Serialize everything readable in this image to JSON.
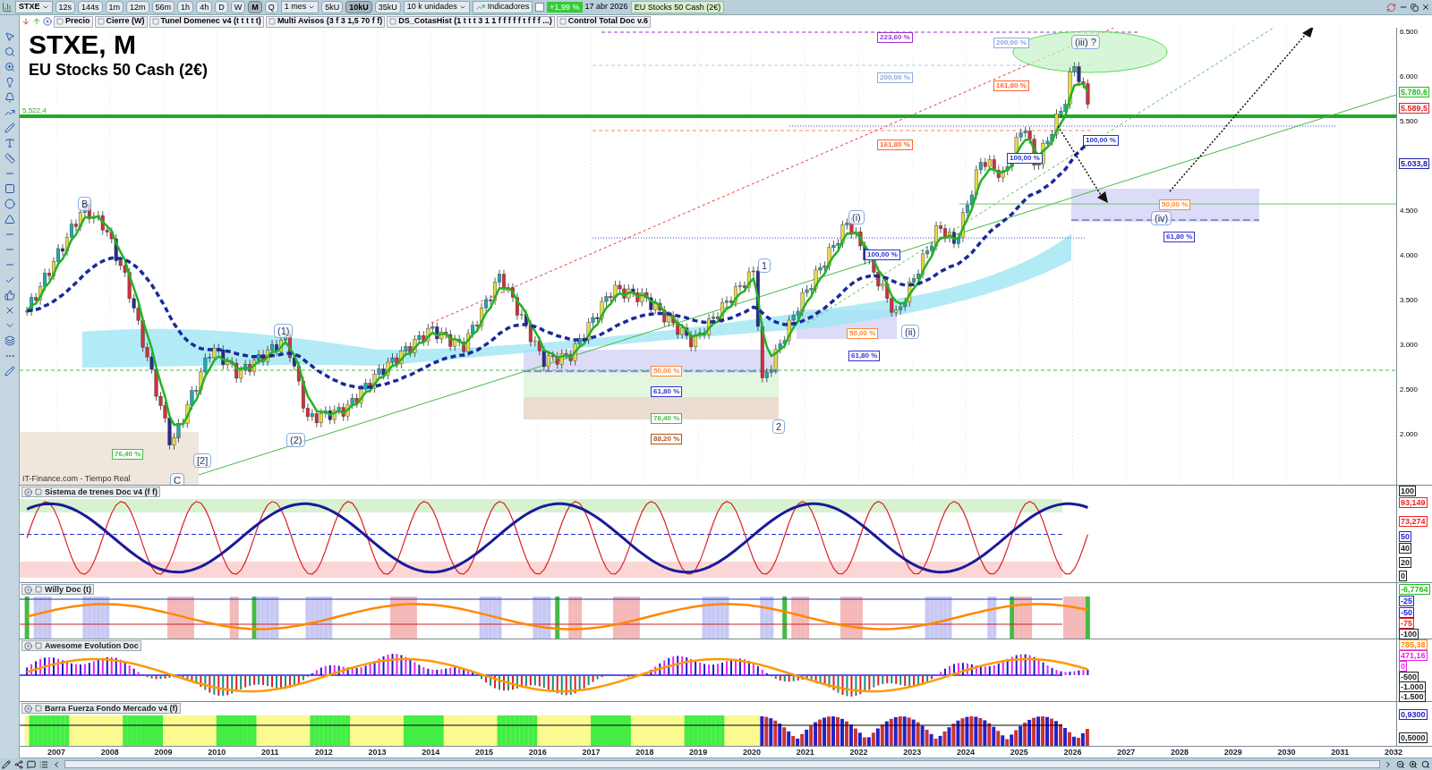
{
  "toolbar": {
    "symbol": "STXE",
    "timeframes": [
      {
        "label": "12s",
        "selected": false
      },
      {
        "label": "144s",
        "selected": false
      },
      {
        "label": "1m",
        "selected": false
      },
      {
        "label": "12m",
        "selected": false
      },
      {
        "label": "56m",
        "selected": false
      },
      {
        "label": "1h",
        "selected": false
      },
      {
        "label": "4h",
        "selected": false
      },
      {
        "label": "D",
        "selected": false
      },
      {
        "label": "W",
        "selected": false
      },
      {
        "label": "M",
        "selected": true
      },
      {
        "label": "Q",
        "selected": false
      }
    ],
    "period": "1 mes",
    "units": [
      {
        "label": "5kU",
        "selected": false
      },
      {
        "label": "10kU",
        "selected": true
      },
      {
        "label": "35kU",
        "selected": false
      }
    ],
    "units_select": "10 k unidades",
    "indicators_button": "Indicadores",
    "change": "+1,99 %",
    "date": "17 abr 2026",
    "instrument": "EU Stocks 50 Cash (2€)"
  },
  "indicator_chips": [
    "Precio",
    "Cierre (W)",
    "Tunel Domenec v4 (t t t t t)",
    "Multi Avisos (3 f 3 1,5 70 f f)",
    "DS_CotasHist (1 t t t 3 1 1 f f f f f t f f f ...)",
    "Control Total Doc v.6"
  ],
  "chart": {
    "title": "STXE, M",
    "subtitle": "EU Stocks 50 Cash (2€)",
    "source": "IT-Finance.com - Tiempo Real",
    "level_label": "5.522,4",
    "price_ticks": [
      "6.500",
      "6.000",
      "5.500",
      "4.500",
      "4.000",
      "3.500",
      "3.000",
      "2.500",
      "2.000"
    ],
    "price_tags": [
      {
        "text": "5.780,6",
        "color": "#22bb22"
      },
      {
        "text": "5.589,5",
        "color": "#dd2222"
      },
      {
        "text": "5.033,8",
        "color": "#2222aa"
      }
    ],
    "wave_labels": [
      "B",
      "C",
      "[2]",
      "(1)",
      "(2)",
      "1",
      "2",
      "(i)",
      "(ii)",
      "(iii) ?",
      "(iv)"
    ],
    "fib_labels": [
      {
        "text": "223,60 %",
        "color": "#9933cc"
      },
      {
        "text": "200,00 %",
        "color": "#8fa8dd"
      },
      {
        "text": "200,00 %",
        "color": "#8fa8dd"
      },
      {
        "text": "161,80 %",
        "color": "#ff6633"
      },
      {
        "text": "161,80 %",
        "color": "#ff6633"
      },
      {
        "text": "100,00 %",
        "color": "#2233cc"
      },
      {
        "text": "100,00 %",
        "color": "#2233cc"
      },
      {
        "text": "100,00 %",
        "color": "#2233cc"
      },
      {
        "text": "50,00 %",
        "color": "#ff8833"
      },
      {
        "text": "61,80 %",
        "color": "#3333cc"
      },
      {
        "text": "50,00 %",
        "color": "#ff8833"
      },
      {
        "text": "61,80 %",
        "color": "#3333cc"
      },
      {
        "text": "76,40 %",
        "color": "#44bb44"
      },
      {
        "text": "88,20 %",
        "color": "#aa5522"
      },
      {
        "text": "76,40 %",
        "color": "#44bb44"
      },
      {
        "text": "50,00 %",
        "color": "#ff8833"
      },
      {
        "text": "61,80 %",
        "color": "#3333cc"
      }
    ]
  },
  "panels": [
    {
      "kind": "trains",
      "title": "Sistema de trenes Doc v4 (f f)",
      "ticks": [
        {
          "text": "100",
          "color": "#222222"
        },
        {
          "text": "93,149",
          "color": "#ee2222"
        },
        {
          "text": "73,274",
          "color": "#ee2222"
        },
        {
          "text": "50",
          "color": "#2222cc"
        },
        {
          "text": "40",
          "color": "#222222"
        },
        {
          "text": "20",
          "color": "#222222"
        },
        {
          "text": "0",
          "color": "#222222"
        }
      ]
    },
    {
      "kind": "willy",
      "title": "Willy Doc (t)",
      "ticks": [
        {
          "text": "-6,7764",
          "color": "#22bb22"
        },
        {
          "text": "-25",
          "color": "#2222cc"
        },
        {
          "text": "-50",
          "color": "#2222cc"
        },
        {
          "text": "-75",
          "color": "#ee2222"
        },
        {
          "text": "-100",
          "color": "#222222"
        }
      ]
    },
    {
      "kind": "awesome",
      "title": "Awesome Evolution Doc",
      "ticks": [
        {
          "text": "785,38",
          "color": "#ff8800"
        },
        {
          "text": "471,16",
          "color": "#ee22ee"
        },
        {
          "text": "0",
          "color": "#ee22ee"
        },
        {
          "text": "-500",
          "color": "#222222"
        },
        {
          "text": "-1.000",
          "color": "#222222"
        },
        {
          "text": "-1.500",
          "color": "#222222"
        }
      ]
    },
    {
      "kind": "strength",
      "title": "Barra Fuerza Fondo Mercado v4 (f)",
      "ticks": [
        {
          "text": "0,9300",
          "color": "#2222cc"
        },
        {
          "text": "0,5000",
          "color": "#222222"
        }
      ]
    }
  ],
  "years": [
    "2007",
    "2008",
    "2009",
    "2010",
    "2011",
    "2012",
    "2013",
    "2014",
    "2015",
    "2016",
    "2017",
    "2018",
    "2019",
    "2020",
    "2021",
    "2022",
    "2023",
    "2024",
    "2025",
    "2026",
    "2027",
    "2028",
    "2029",
    "2030",
    "2031",
    "2032"
  ]
}
